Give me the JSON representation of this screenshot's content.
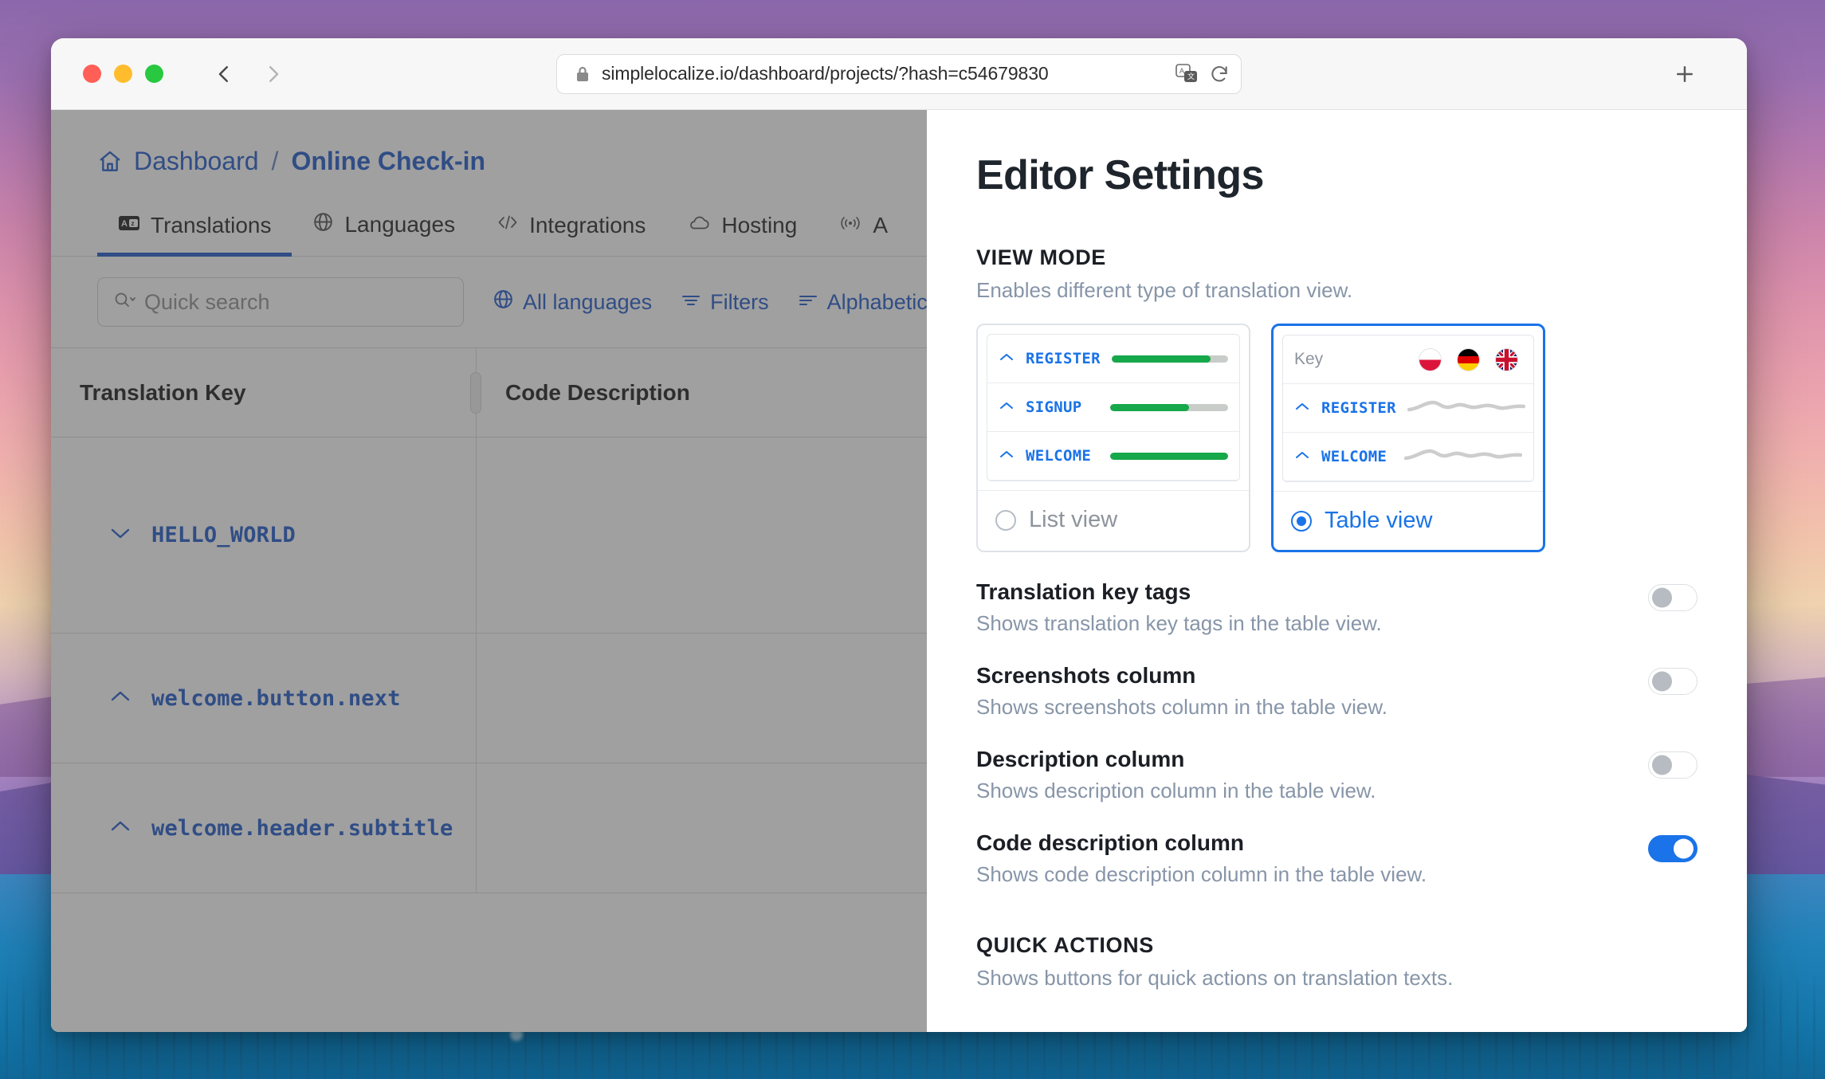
{
  "browser": {
    "url": "simplelocalize.io/dashboard/projects/?hash=c54679830",
    "lock_icon": "lock-icon",
    "translate_icon": "translate-page-icon",
    "reload_icon": "reload-icon",
    "back_icon": "back-arrow-icon",
    "forward_icon": "forward-arrow-icon",
    "newtab_icon": "plus-icon"
  },
  "app": {
    "breadcrumb": {
      "home_icon": "home-icon",
      "root": "Dashboard",
      "separator": "/",
      "current": "Online Check-in"
    },
    "tabs": [
      {
        "label": "Translations",
        "icon": "translations-icon",
        "active": true
      },
      {
        "label": "Languages",
        "icon": "globe-icon",
        "active": false
      },
      {
        "label": "Integrations",
        "icon": "code-icon",
        "active": false
      },
      {
        "label": "Hosting",
        "icon": "cloud-icon",
        "active": false
      },
      {
        "label": "A",
        "icon": "broadcast-icon",
        "active": false
      }
    ],
    "toolbar": {
      "search_placeholder": "Quick search",
      "search_value": "",
      "search_icon": "search-icon",
      "buttons": [
        {
          "label": "All languages",
          "icon": "globe-icon"
        },
        {
          "label": "Filters",
          "icon": "filter-icon"
        },
        {
          "label": "Alphabetical",
          "icon": "sort-icon"
        }
      ]
    },
    "table": {
      "columns": [
        "Translation Key",
        "Code Description"
      ],
      "rows": [
        {
          "key": "HELLO_WORLD",
          "chevron": "chevron-down-icon",
          "code_description": ""
        },
        {
          "key": "welcome.button.next",
          "chevron": "chevron-up-icon",
          "code_description": ""
        },
        {
          "key": "welcome.header.subtitle",
          "chevron": "chevron-up-icon",
          "code_description": ""
        }
      ]
    }
  },
  "drawer": {
    "title": "Editor Settings",
    "view_mode": {
      "label": "VIEW MODE",
      "description": "Enables different type of translation view.",
      "options": [
        {
          "id": "list",
          "label": "List view",
          "selected": false,
          "preview_rows": [
            {
              "key": "REGISTER",
              "progress": 85
            },
            {
              "key": "SIGNUP",
              "progress": 67
            },
            {
              "key": "WELCOME",
              "progress": 100
            }
          ]
        },
        {
          "id": "table",
          "label": "Table view",
          "selected": true,
          "header_key": "Key",
          "flags": [
            "poland-flag-icon",
            "germany-flag-icon",
            "united-kingdom-flag-icon"
          ],
          "preview_rows": [
            {
              "key": "REGISTER"
            },
            {
              "key": "WELCOME"
            }
          ]
        }
      ]
    },
    "settings": [
      {
        "name": "Translation key tags",
        "description": "Shows translation key tags in the table view.",
        "enabled": false
      },
      {
        "name": "Screenshots column",
        "description": "Shows screenshots column in the table view.",
        "enabled": false
      },
      {
        "name": "Description column",
        "description": "Shows description column in the table view.",
        "enabled": false
      },
      {
        "name": "Code description column",
        "description": "Shows code description column in the table view.",
        "enabled": true
      }
    ],
    "quick_actions": {
      "label": "QUICK ACTIONS",
      "description": "Shows buttons for quick actions on translation texts."
    }
  },
  "colors": {
    "accent_blue": "#1a73e8",
    "link_blue": "#1552c7",
    "progress_green": "#16a84a",
    "muted_text": "#8795a8"
  }
}
